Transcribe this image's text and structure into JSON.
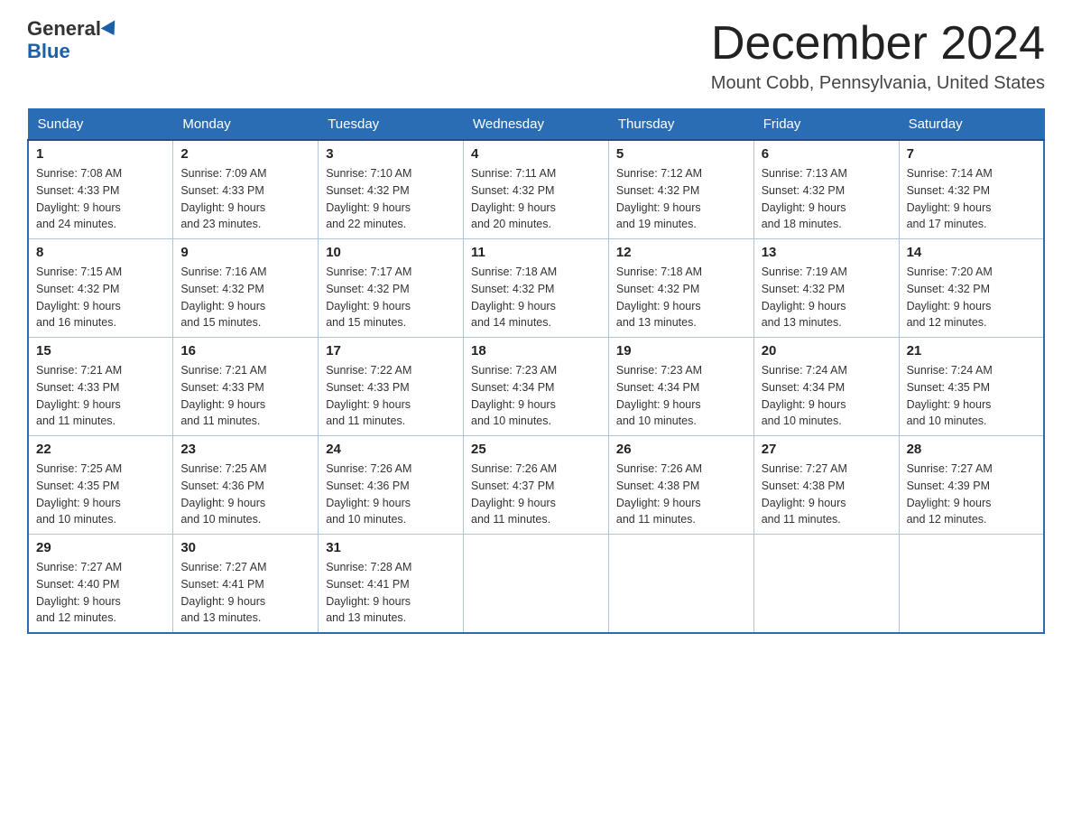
{
  "logo": {
    "line1": "General",
    "line2": "Blue"
  },
  "header": {
    "title": "December 2024",
    "location": "Mount Cobb, Pennsylvania, United States"
  },
  "days_of_week": [
    "Sunday",
    "Monday",
    "Tuesday",
    "Wednesday",
    "Thursday",
    "Friday",
    "Saturday"
  ],
  "weeks": [
    [
      {
        "day": "1",
        "sunrise": "7:08 AM",
        "sunset": "4:33 PM",
        "daylight": "9 hours and 24 minutes."
      },
      {
        "day": "2",
        "sunrise": "7:09 AM",
        "sunset": "4:33 PM",
        "daylight": "9 hours and 23 minutes."
      },
      {
        "day": "3",
        "sunrise": "7:10 AM",
        "sunset": "4:32 PM",
        "daylight": "9 hours and 22 minutes."
      },
      {
        "day": "4",
        "sunrise": "7:11 AM",
        "sunset": "4:32 PM",
        "daylight": "9 hours and 20 minutes."
      },
      {
        "day": "5",
        "sunrise": "7:12 AM",
        "sunset": "4:32 PM",
        "daylight": "9 hours and 19 minutes."
      },
      {
        "day": "6",
        "sunrise": "7:13 AM",
        "sunset": "4:32 PM",
        "daylight": "9 hours and 18 minutes."
      },
      {
        "day": "7",
        "sunrise": "7:14 AM",
        "sunset": "4:32 PM",
        "daylight": "9 hours and 17 minutes."
      }
    ],
    [
      {
        "day": "8",
        "sunrise": "7:15 AM",
        "sunset": "4:32 PM",
        "daylight": "9 hours and 16 minutes."
      },
      {
        "day": "9",
        "sunrise": "7:16 AM",
        "sunset": "4:32 PM",
        "daylight": "9 hours and 15 minutes."
      },
      {
        "day": "10",
        "sunrise": "7:17 AM",
        "sunset": "4:32 PM",
        "daylight": "9 hours and 15 minutes."
      },
      {
        "day": "11",
        "sunrise": "7:18 AM",
        "sunset": "4:32 PM",
        "daylight": "9 hours and 14 minutes."
      },
      {
        "day": "12",
        "sunrise": "7:18 AM",
        "sunset": "4:32 PM",
        "daylight": "9 hours and 13 minutes."
      },
      {
        "day": "13",
        "sunrise": "7:19 AM",
        "sunset": "4:32 PM",
        "daylight": "9 hours and 13 minutes."
      },
      {
        "day": "14",
        "sunrise": "7:20 AM",
        "sunset": "4:32 PM",
        "daylight": "9 hours and 12 minutes."
      }
    ],
    [
      {
        "day": "15",
        "sunrise": "7:21 AM",
        "sunset": "4:33 PM",
        "daylight": "9 hours and 11 minutes."
      },
      {
        "day": "16",
        "sunrise": "7:21 AM",
        "sunset": "4:33 PM",
        "daylight": "9 hours and 11 minutes."
      },
      {
        "day": "17",
        "sunrise": "7:22 AM",
        "sunset": "4:33 PM",
        "daylight": "9 hours and 11 minutes."
      },
      {
        "day": "18",
        "sunrise": "7:23 AM",
        "sunset": "4:34 PM",
        "daylight": "9 hours and 10 minutes."
      },
      {
        "day": "19",
        "sunrise": "7:23 AM",
        "sunset": "4:34 PM",
        "daylight": "9 hours and 10 minutes."
      },
      {
        "day": "20",
        "sunrise": "7:24 AM",
        "sunset": "4:34 PM",
        "daylight": "9 hours and 10 minutes."
      },
      {
        "day": "21",
        "sunrise": "7:24 AM",
        "sunset": "4:35 PM",
        "daylight": "9 hours and 10 minutes."
      }
    ],
    [
      {
        "day": "22",
        "sunrise": "7:25 AM",
        "sunset": "4:35 PM",
        "daylight": "9 hours and 10 minutes."
      },
      {
        "day": "23",
        "sunrise": "7:25 AM",
        "sunset": "4:36 PM",
        "daylight": "9 hours and 10 minutes."
      },
      {
        "day": "24",
        "sunrise": "7:26 AM",
        "sunset": "4:36 PM",
        "daylight": "9 hours and 10 minutes."
      },
      {
        "day": "25",
        "sunrise": "7:26 AM",
        "sunset": "4:37 PM",
        "daylight": "9 hours and 11 minutes."
      },
      {
        "day": "26",
        "sunrise": "7:26 AM",
        "sunset": "4:38 PM",
        "daylight": "9 hours and 11 minutes."
      },
      {
        "day": "27",
        "sunrise": "7:27 AM",
        "sunset": "4:38 PM",
        "daylight": "9 hours and 11 minutes."
      },
      {
        "day": "28",
        "sunrise": "7:27 AM",
        "sunset": "4:39 PM",
        "daylight": "9 hours and 12 minutes."
      }
    ],
    [
      {
        "day": "29",
        "sunrise": "7:27 AM",
        "sunset": "4:40 PM",
        "daylight": "9 hours and 12 minutes."
      },
      {
        "day": "30",
        "sunrise": "7:27 AM",
        "sunset": "4:41 PM",
        "daylight": "9 hours and 13 minutes."
      },
      {
        "day": "31",
        "sunrise": "7:28 AM",
        "sunset": "4:41 PM",
        "daylight": "9 hours and 13 minutes."
      },
      null,
      null,
      null,
      null
    ]
  ],
  "colors": {
    "header_bg": "#2a6db5",
    "header_text": "#ffffff",
    "border": "#8aabcc",
    "accent": "#1a5fa8"
  }
}
